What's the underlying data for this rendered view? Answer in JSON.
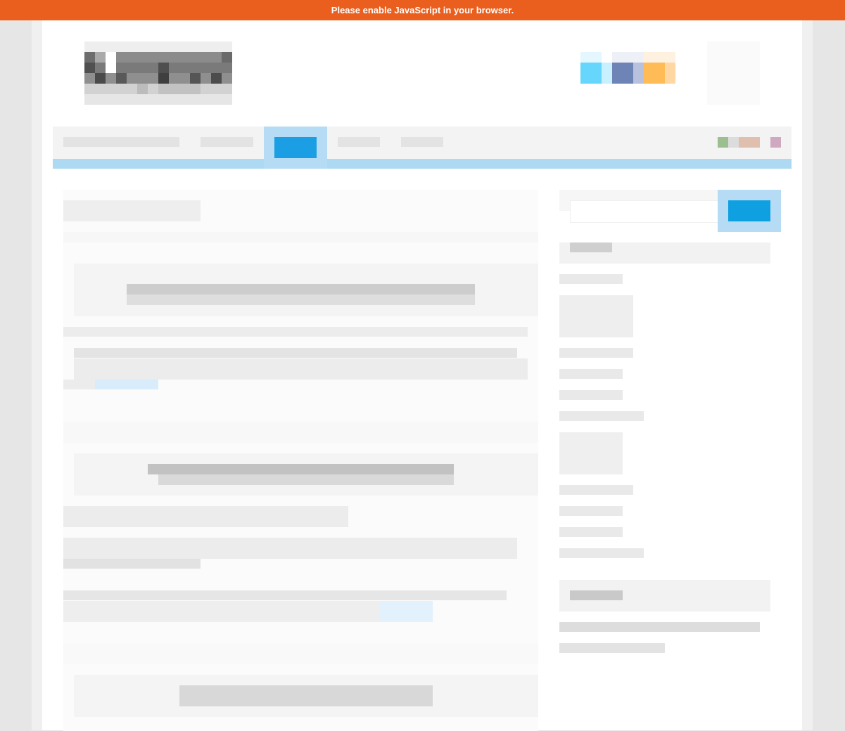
{
  "banner": {
    "message": "Please enable JavaScript in your browser."
  },
  "colors": {
    "banner_bg": "#ea5f1e",
    "accent": "#1b9ee3",
    "nav_underline": "#addaf2",
    "page_bg": "#ffffff",
    "frame_bg": "#e6e6e6"
  },
  "header": {
    "logo_icon": "site-logo",
    "social_icons": [
      "twitter-icon",
      "facebook-icon",
      "rss-icon"
    ]
  },
  "nav": {
    "items": [
      "",
      "",
      "",
      "",
      ""
    ],
    "active_index": 2
  },
  "sidebar": {
    "search_placeholder": "",
    "search_button_icon": "search-icon"
  }
}
